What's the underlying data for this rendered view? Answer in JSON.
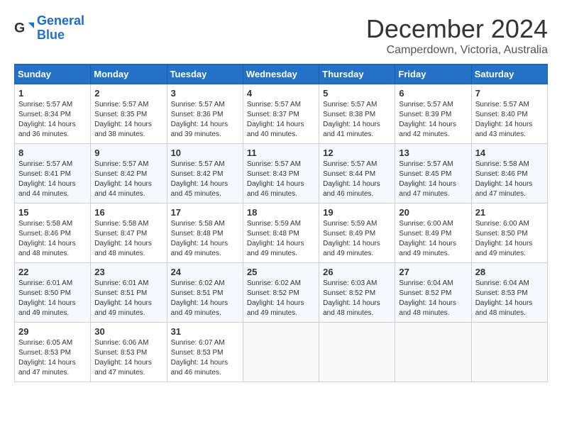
{
  "logo": {
    "line1": "General",
    "line2": "Blue"
  },
  "title": "December 2024",
  "location": "Camperdown, Victoria, Australia",
  "days_header": [
    "Sunday",
    "Monday",
    "Tuesday",
    "Wednesday",
    "Thursday",
    "Friday",
    "Saturday"
  ],
  "weeks": [
    [
      {
        "day": "1",
        "sunrise": "5:57 AM",
        "sunset": "8:34 PM",
        "daylight": "14 hours and 36 minutes."
      },
      {
        "day": "2",
        "sunrise": "5:57 AM",
        "sunset": "8:35 PM",
        "daylight": "14 hours and 38 minutes."
      },
      {
        "day": "3",
        "sunrise": "5:57 AM",
        "sunset": "8:36 PM",
        "daylight": "14 hours and 39 minutes."
      },
      {
        "day": "4",
        "sunrise": "5:57 AM",
        "sunset": "8:37 PM",
        "daylight": "14 hours and 40 minutes."
      },
      {
        "day": "5",
        "sunrise": "5:57 AM",
        "sunset": "8:38 PM",
        "daylight": "14 hours and 41 minutes."
      },
      {
        "day": "6",
        "sunrise": "5:57 AM",
        "sunset": "8:39 PM",
        "daylight": "14 hours and 42 minutes."
      },
      {
        "day": "7",
        "sunrise": "5:57 AM",
        "sunset": "8:40 PM",
        "daylight": "14 hours and 43 minutes."
      }
    ],
    [
      {
        "day": "8",
        "sunrise": "5:57 AM",
        "sunset": "8:41 PM",
        "daylight": "14 hours and 44 minutes."
      },
      {
        "day": "9",
        "sunrise": "5:57 AM",
        "sunset": "8:42 PM",
        "daylight": "14 hours and 44 minutes."
      },
      {
        "day": "10",
        "sunrise": "5:57 AM",
        "sunset": "8:42 PM",
        "daylight": "14 hours and 45 minutes."
      },
      {
        "day": "11",
        "sunrise": "5:57 AM",
        "sunset": "8:43 PM",
        "daylight": "14 hours and 46 minutes."
      },
      {
        "day": "12",
        "sunrise": "5:57 AM",
        "sunset": "8:44 PM",
        "daylight": "14 hours and 46 minutes."
      },
      {
        "day": "13",
        "sunrise": "5:57 AM",
        "sunset": "8:45 PM",
        "daylight": "14 hours and 47 minutes."
      },
      {
        "day": "14",
        "sunrise": "5:58 AM",
        "sunset": "8:46 PM",
        "daylight": "14 hours and 47 minutes."
      }
    ],
    [
      {
        "day": "15",
        "sunrise": "5:58 AM",
        "sunset": "8:46 PM",
        "daylight": "14 hours and 48 minutes."
      },
      {
        "day": "16",
        "sunrise": "5:58 AM",
        "sunset": "8:47 PM",
        "daylight": "14 hours and 48 minutes."
      },
      {
        "day": "17",
        "sunrise": "5:58 AM",
        "sunset": "8:48 PM",
        "daylight": "14 hours and 49 minutes."
      },
      {
        "day": "18",
        "sunrise": "5:59 AM",
        "sunset": "8:48 PM",
        "daylight": "14 hours and 49 minutes."
      },
      {
        "day": "19",
        "sunrise": "5:59 AM",
        "sunset": "8:49 PM",
        "daylight": "14 hours and 49 minutes."
      },
      {
        "day": "20",
        "sunrise": "6:00 AM",
        "sunset": "8:49 PM",
        "daylight": "14 hours and 49 minutes."
      },
      {
        "day": "21",
        "sunrise": "6:00 AM",
        "sunset": "8:50 PM",
        "daylight": "14 hours and 49 minutes."
      }
    ],
    [
      {
        "day": "22",
        "sunrise": "6:01 AM",
        "sunset": "8:50 PM",
        "daylight": "14 hours and 49 minutes."
      },
      {
        "day": "23",
        "sunrise": "6:01 AM",
        "sunset": "8:51 PM",
        "daylight": "14 hours and 49 minutes."
      },
      {
        "day": "24",
        "sunrise": "6:02 AM",
        "sunset": "8:51 PM",
        "daylight": "14 hours and 49 minutes."
      },
      {
        "day": "25",
        "sunrise": "6:02 AM",
        "sunset": "8:52 PM",
        "daylight": "14 hours and 49 minutes."
      },
      {
        "day": "26",
        "sunrise": "6:03 AM",
        "sunset": "8:52 PM",
        "daylight": "14 hours and 48 minutes."
      },
      {
        "day": "27",
        "sunrise": "6:04 AM",
        "sunset": "8:52 PM",
        "daylight": "14 hours and 48 minutes."
      },
      {
        "day": "28",
        "sunrise": "6:04 AM",
        "sunset": "8:53 PM",
        "daylight": "14 hours and 48 minutes."
      }
    ],
    [
      {
        "day": "29",
        "sunrise": "6:05 AM",
        "sunset": "8:53 PM",
        "daylight": "14 hours and 47 minutes."
      },
      {
        "day": "30",
        "sunrise": "6:06 AM",
        "sunset": "8:53 PM",
        "daylight": "14 hours and 47 minutes."
      },
      {
        "day": "31",
        "sunrise": "6:07 AM",
        "sunset": "8:53 PM",
        "daylight": "14 hours and 46 minutes."
      },
      null,
      null,
      null,
      null
    ]
  ]
}
